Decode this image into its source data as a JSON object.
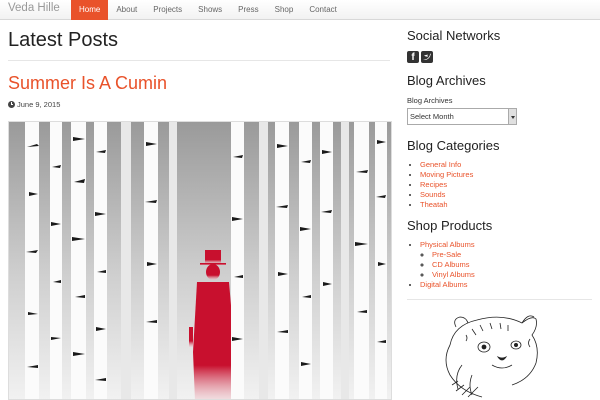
{
  "site": {
    "brand": "Veda Hille"
  },
  "nav": {
    "items": [
      {
        "label": "Home",
        "active": true
      },
      {
        "label": "About",
        "active": false
      },
      {
        "label": "Projects",
        "active": false
      },
      {
        "label": "Shows",
        "active": false
      },
      {
        "label": "Press",
        "active": false
      },
      {
        "label": "Shop",
        "active": false
      },
      {
        "label": "Contact",
        "active": false
      }
    ]
  },
  "main": {
    "page_title": "Latest Posts",
    "post": {
      "title": "Summer Is A Cumin",
      "date": "June 9, 2015",
      "date_icon": "clock-icon"
    }
  },
  "sidebar": {
    "social": {
      "title": "Social Networks",
      "icons": [
        "facebook-icon",
        "twitter-icon"
      ]
    },
    "archives": {
      "title": "Blog Archives",
      "label": "Blog Archives",
      "select_value": "Select Month"
    },
    "categories": {
      "title": "Blog Categories",
      "items": [
        "General Info",
        "Moving Pictures",
        "Recipes",
        "Sounds",
        "Theatah"
      ]
    },
    "shop": {
      "title": "Shop Products",
      "items": [
        {
          "label": "Physical Albums",
          "children": [
            "Pre-Sale",
            "CD Albums",
            "Vinyl Albums"
          ]
        },
        {
          "label": "Digital Albums",
          "children": []
        }
      ]
    }
  },
  "colors": {
    "accent": "#e9522a",
    "figure": "#c8102e",
    "text": "#333333"
  }
}
